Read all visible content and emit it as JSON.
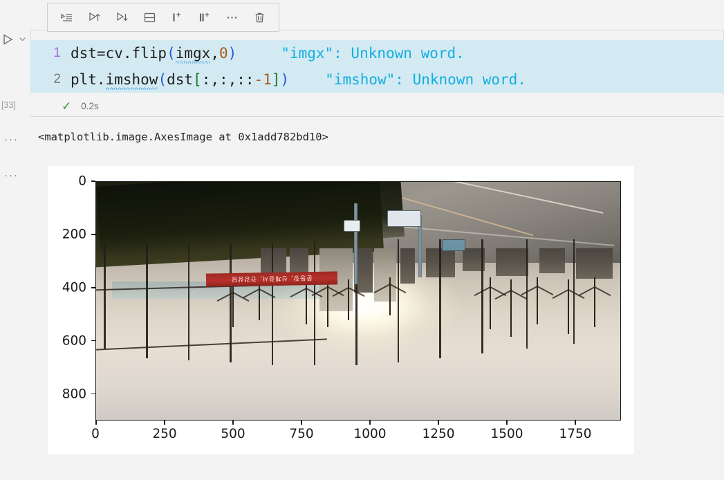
{
  "toolbar": {
    "buttons": [
      {
        "name": "run-by-line-icon",
        "label": "Run By Line"
      },
      {
        "name": "execute-above-cells-icon",
        "label": "Execute Above Cells"
      },
      {
        "name": "execute-cell-and-below-icon",
        "label": "Execute Cell and Below"
      },
      {
        "name": "split-cell-icon",
        "label": "Split Cell"
      },
      {
        "name": "insert-cell-above-icon",
        "label": "Insert Cell Above"
      },
      {
        "name": "insert-cell-below-icon",
        "label": "Insert Cell Below"
      },
      {
        "name": "more-actions-icon",
        "label": "More Actions..."
      },
      {
        "name": "delete-cell-icon",
        "label": "Delete Cell"
      }
    ]
  },
  "gutter": {
    "execution_count": "[33]",
    "run_icon": "play-icon",
    "chevron_icon": "chevron-down-icon",
    "output_collapse_1": "···",
    "output_collapse_2": "···"
  },
  "cell": {
    "status": {
      "check_icon": "✓",
      "elapsed": "0.2s"
    },
    "lines": [
      {
        "number": "1",
        "tokens": [
          {
            "t": "dst=cv",
            "c": "plain"
          },
          {
            "t": ".",
            "c": "plain"
          },
          {
            "t": "flip",
            "c": "plain"
          },
          {
            "t": "(",
            "c": "blue"
          },
          {
            "t": "imgx",
            "c": "plain",
            "squiggle": true
          },
          {
            "t": ",",
            "c": "plain"
          },
          {
            "t": "0",
            "c": "orange"
          },
          {
            "t": ")",
            "c": "blue"
          }
        ],
        "hint": "\"imgx\": Unknown word."
      },
      {
        "number": "2",
        "tokens": [
          {
            "t": "plt",
            "c": "plain"
          },
          {
            "t": ".",
            "c": "plain"
          },
          {
            "t": "imshow",
            "c": "plain",
            "squiggle": true
          },
          {
            "t": "(",
            "c": "blue"
          },
          {
            "t": "dst",
            "c": "plain"
          },
          {
            "t": "[",
            "c": "green"
          },
          {
            "t": ":,:,::",
            "c": "plain"
          },
          {
            "t": "-1",
            "c": "orange"
          },
          {
            "t": "]",
            "c": "green"
          },
          {
            "t": ")",
            "c": "blue"
          }
        ],
        "hint": "\"imshow\": Unknown word."
      }
    ]
  },
  "output": {
    "text": "<matplotlib.image.AxesImage at 0x1add782bd10>"
  },
  "chart_data": {
    "type": "heatmap",
    "title": "",
    "xlabel": "",
    "ylabel": "",
    "description": "matplotlib imshow of a vertically flipped (cv.flip axis 0) BGR->RGB converted photograph of an outdoor plaza / street scene at sunset",
    "x_ticks": [
      0,
      250,
      500,
      750,
      1000,
      1250,
      1500,
      1750
    ],
    "y_ticks": [
      0,
      200,
      400,
      600,
      800
    ],
    "xlim": [
      0,
      1920
    ],
    "ylim": [
      900,
      0
    ],
    "grid": false,
    "legend": null,
    "image_shape": [
      900,
      1920,
      3
    ],
    "banner_text": "운동장, 신체검사, 건강상담"
  }
}
